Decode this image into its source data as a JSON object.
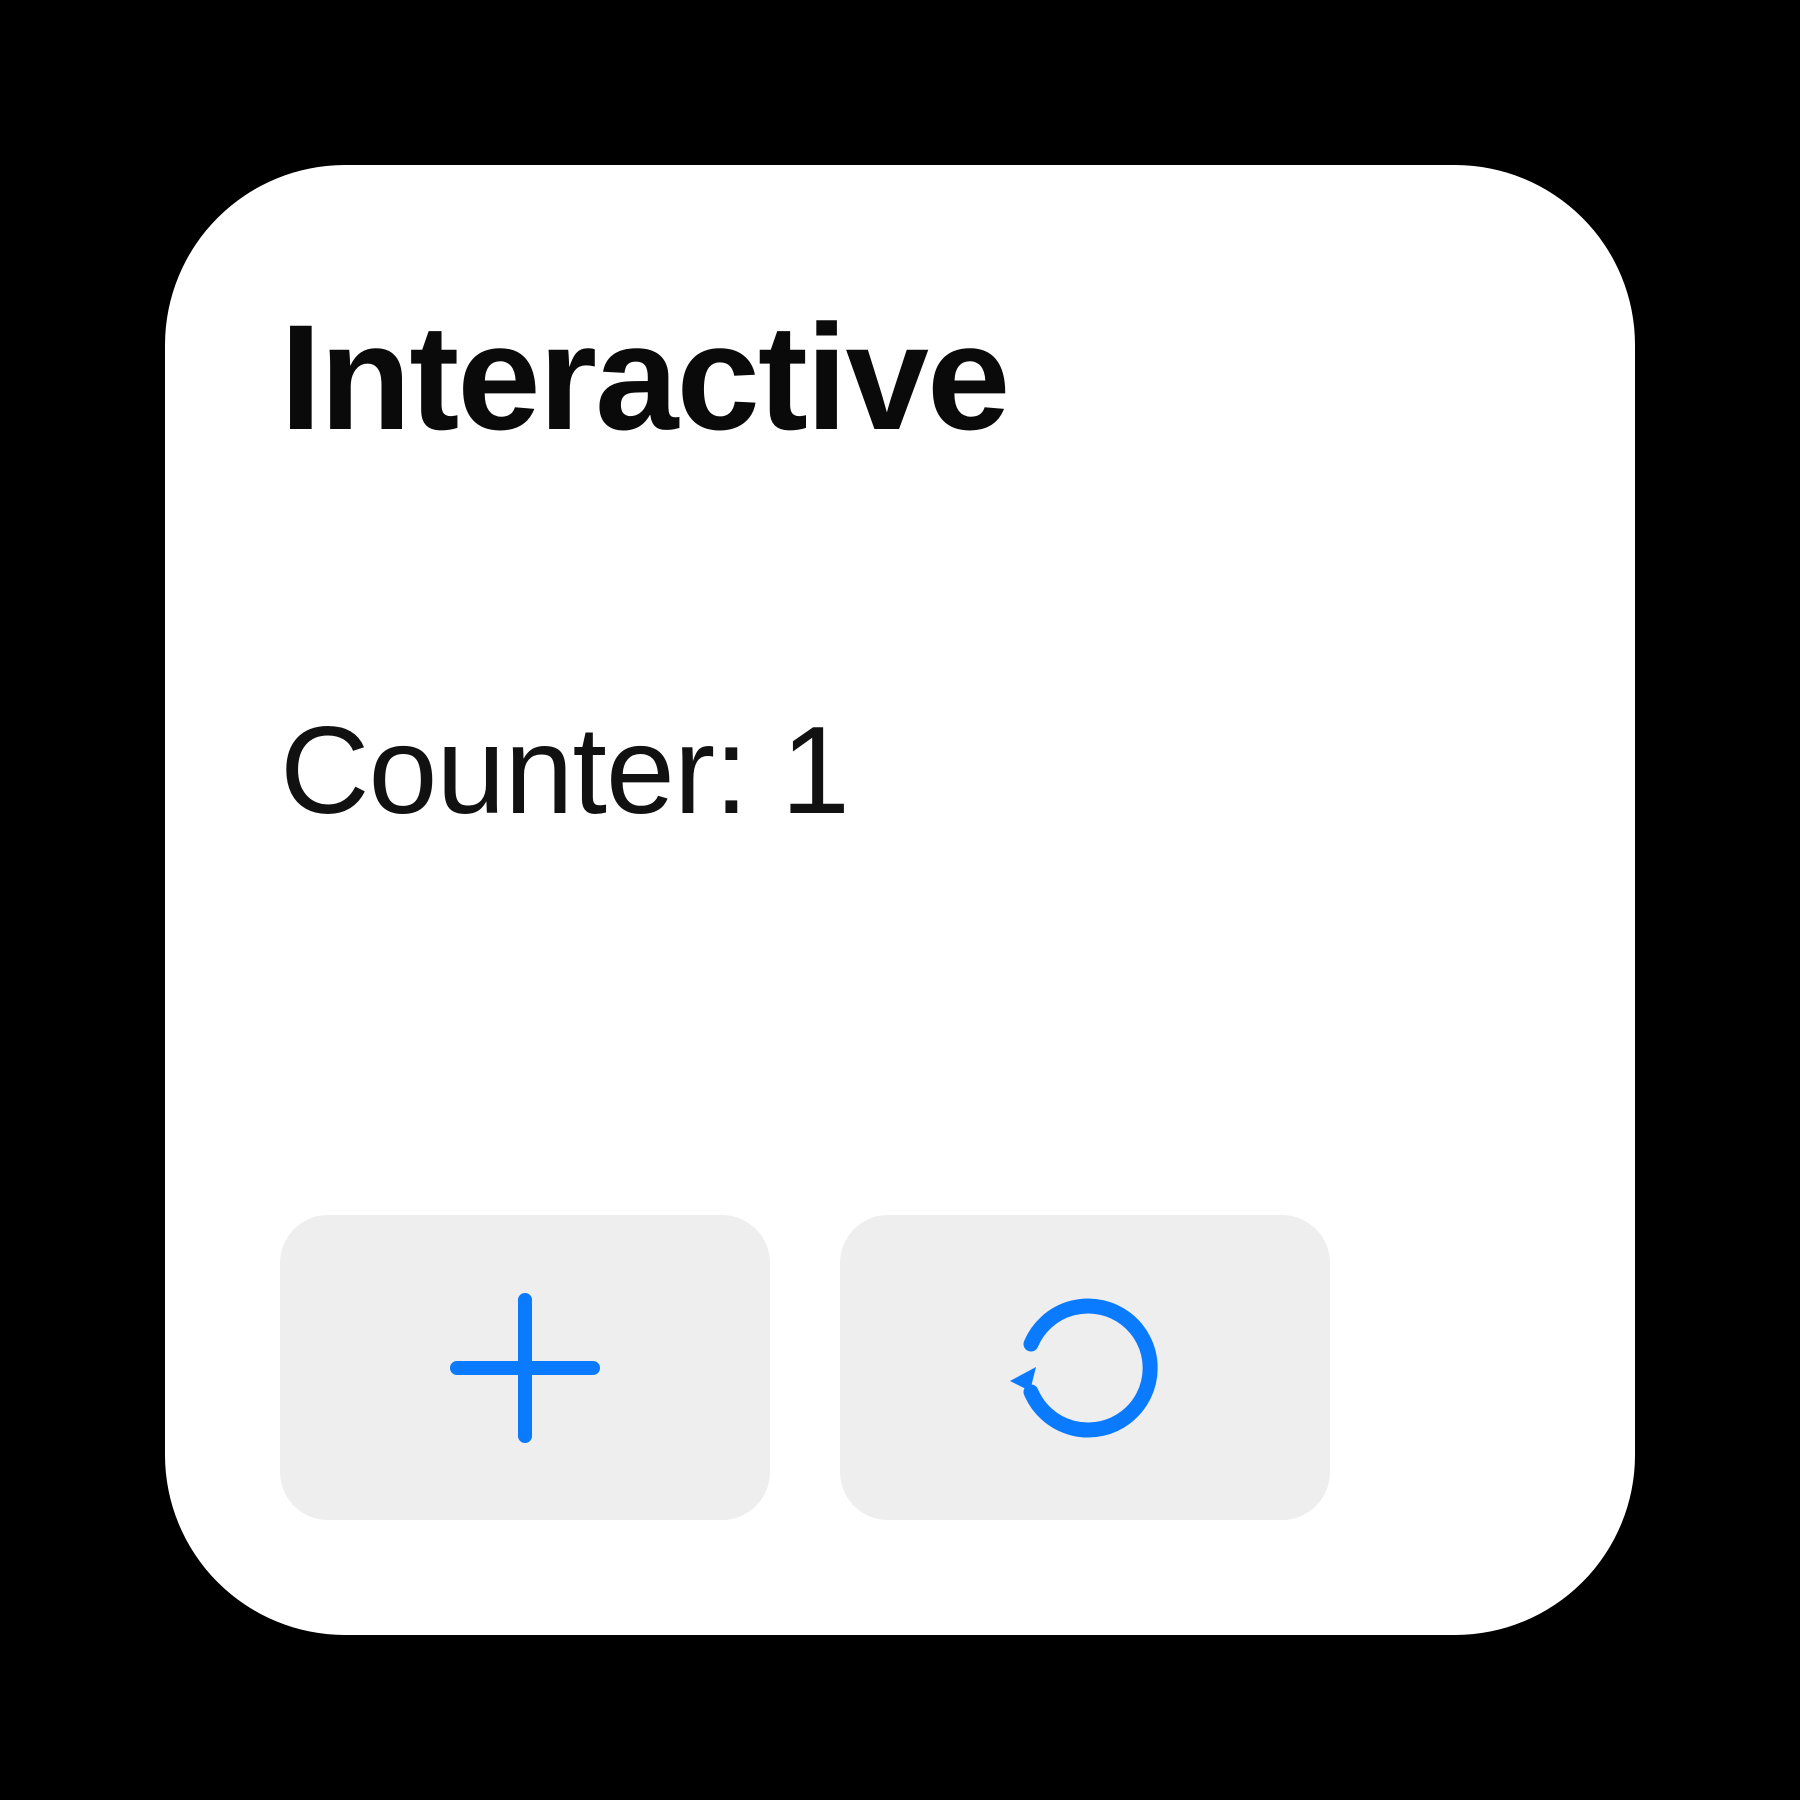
{
  "widget": {
    "title": "Interactive",
    "counter_label": "Counter: 1",
    "counter_value": 1,
    "accent_color": "#0a7aff",
    "button_bg": "#eeeeee",
    "buttons": {
      "increment_icon": "plus",
      "reset_icon": "reset-arrow-ccw"
    }
  }
}
